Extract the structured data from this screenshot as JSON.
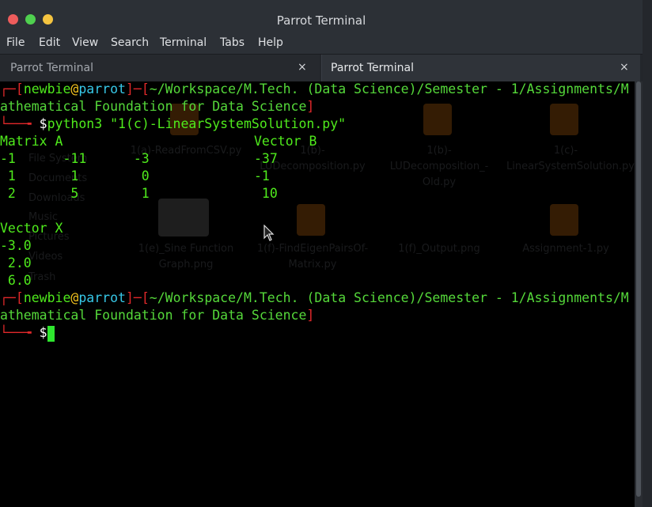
{
  "window": {
    "title": "Parrot Terminal"
  },
  "menu": [
    "File",
    "Edit",
    "View",
    "Search",
    "Terminal",
    "Tabs",
    "Help"
  ],
  "tabs": [
    {
      "label": "Parrot Terminal",
      "close": "×"
    },
    {
      "label": "Parrot Terminal",
      "close": "×"
    }
  ],
  "prompt1": {
    "corner": "┌─[",
    "user": "newbie",
    "at": "@",
    "host": "parrot",
    "sep": "]─[",
    "path_line1": "~/Workspace/M.Tech. (Data Science)/Semester - 1/Assignments/M",
    "path_line2": "athematical Foundation for Data Science",
    "close": "]",
    "arrow": "└──╼ ",
    "dollar": "$",
    "command": "python3 \"1(c)-LinearSystemSolution.py\""
  },
  "output": {
    "matrix_label": "Matrix A",
    "vector_b_label": "Vector B",
    "rows": [
      {
        "a": "-1      -11      -3",
        "b": "-37"
      },
      {
        "a": " 1       1        0",
        "b": "-1"
      },
      {
        "a": " 2       5        1",
        "b": " 10"
      }
    ],
    "vector_x_label": "Vector X",
    "x_values": [
      "-3.0",
      " 2.0",
      " 6.0"
    ]
  },
  "prompt2": {
    "corner": "┌─[",
    "user": "newbie",
    "at": "@",
    "host": "parrot",
    "sep": "]─[",
    "path_line1": "~/Workspace/M.Tech. (Data Science)/Semester - 1/Assignments/M",
    "path_line2": "athematical Foundation for Data Science",
    "close": "]",
    "arrow": "└──╼ ",
    "dollar": "$"
  },
  "background_files": [
    "1(a)-ReadFromCSV.py",
    "1(b)-LUDecomposition.py",
    "1(b)-LUDecomposition_-Old.py",
    "1(c)-LinearSystemSolution.py",
    "1(e)_Sine Function Graph.png",
    "1(f)-FindEigenPairsOf-Matrix.py",
    "1(f)_Output.png",
    "Assignment-1.py"
  ],
  "background_sidebar": [
    "File System",
    "Documents",
    "Downloads",
    "Music",
    "Pictures",
    "Videos",
    "Trash"
  ],
  "colors": {
    "prompt_red": "#e0282a",
    "prompt_green": "#4fea1c",
    "host_cyan": "#37c8e8",
    "at_yellow": "#f2c21f",
    "cursor": "#2ee62e"
  }
}
